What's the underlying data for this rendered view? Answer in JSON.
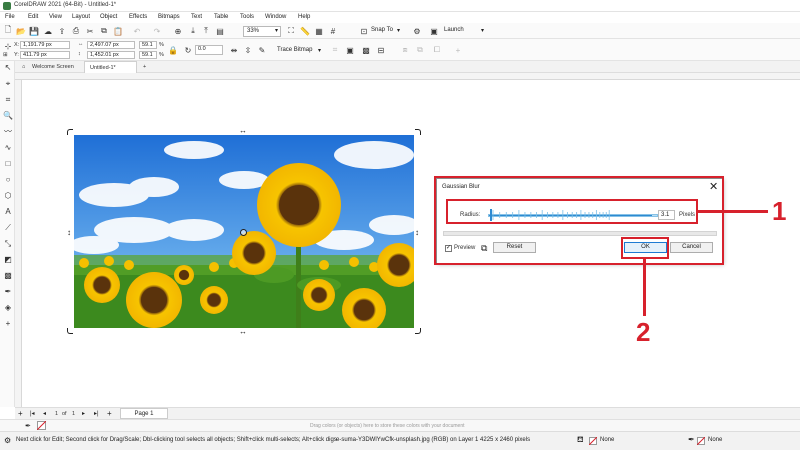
{
  "window": {
    "title": "CorelDRAW 2021 (64-Bit) - Untitled-1*"
  },
  "menu": [
    "File",
    "Edit",
    "View",
    "Layout",
    "Object",
    "Effects",
    "Bitmaps",
    "Text",
    "Table",
    "Tools",
    "Window",
    "Help"
  ],
  "toolbar": {
    "zoom_value": "33%",
    "snap_label": "Snap To",
    "launch_label": "Launch"
  },
  "property_bar": {
    "x_label": "X:",
    "x_value": "1,191.79 px",
    "y_label": "Y:",
    "y_value": "411.79 px",
    "width_value": "2,497.07 px",
    "height_value": "1,452.01 px",
    "scale_w": "59.1",
    "scale_h": "59.1",
    "pct": "%",
    "rotation_value": "0.0",
    "trace_bitmap_label": "Trace Bitmap"
  },
  "doc_tabs": [
    "Welcome Screen",
    "Untitled-1*"
  ],
  "dialog": {
    "title": "Gaussian Blur",
    "radius_label": "Radius:",
    "radius_value": "3.1",
    "radius_fraction": 0.97,
    "units_label": "Pixels",
    "preview_label": "Preview",
    "preview_checked": true,
    "reset_label": "Reset",
    "ok_label": "OK",
    "cancel_label": "Cancel"
  },
  "annotations": {
    "label_1": "1",
    "label_2": "2",
    "color": "#d7212c"
  },
  "page_nav": {
    "current": "1",
    "of_label": "of",
    "total": "1",
    "page_tab": "Page 1"
  },
  "colorbar": {
    "hint": "Drag colors (or objects) here to store these colors with your document"
  },
  "status": {
    "hint": "Next click for Edit; Second click for Drag/Scale; Dbl-clicking tool selects all objects; Shift+click multi-selects; Alt+click digs",
    "object_info": "e-suma-Y3DWlYwCfk-unsplash.jpg (RGB) on Layer 1 4225 x 2460 pixels",
    "fill_label": "None",
    "outline_label": "None"
  }
}
